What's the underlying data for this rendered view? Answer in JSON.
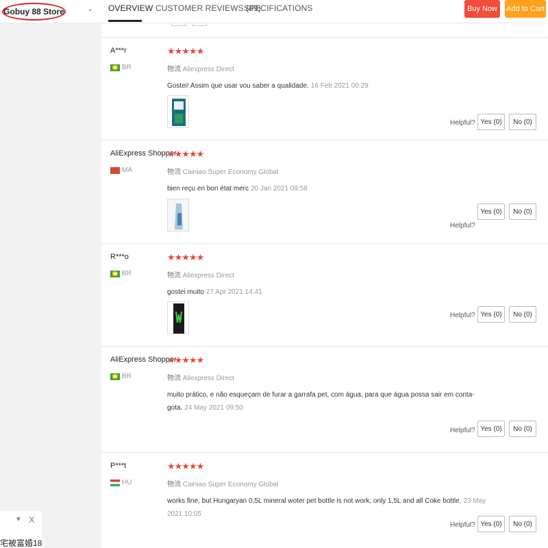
{
  "store": {
    "name": "Gobuy 88 Store",
    "chevron_icon": "chevron-down-icon"
  },
  "nav": {
    "tabs": [
      {
        "label": "OVERVIEW",
        "active": true
      },
      {
        "label": "CUSTOMER REVIEWS (89)",
        "active": false
      },
      {
        "label": "SPECIFICATIONS",
        "active": false
      }
    ],
    "buy_now": "Buy Now",
    "add_to_cart": "Add to Cart"
  },
  "colors": {
    "buy_now": "#f04d3b",
    "add_to_cart": "#ffa11d",
    "stars": "#e64a3b"
  },
  "helpful_label": "Helpful?",
  "reviews": [
    {
      "name": "A***r",
      "country": "BR",
      "stars": "★★★★★",
      "rating": 5,
      "shipping_prefix": "物流",
      "shipping": "Aliexpress Direct",
      "text": "Gostei! Assim que usar vou saber a qualidade.",
      "date": "16 Feb 2021 00:29",
      "yes": "Yes (0)",
      "no": "No (0)"
    },
    {
      "name": "AliExpress Shopper",
      "country": "MA",
      "stars": "★★★★★",
      "rating": 5,
      "shipping_prefix": "物流",
      "shipping": "Cainiao Super Economy Global",
      "text": "bien reçu en bon état merc",
      "date": "20 Jan 2021 09:58",
      "yes": "Yes (0)",
      "no": "No (0)"
    },
    {
      "name": "R***o",
      "country": "BR",
      "stars": "★★★★★",
      "rating": 5,
      "shipping_prefix": "物流",
      "shipping": "Aliexpress Direct",
      "text": "gostei muito",
      "date": "27 Apr 2021 14:41",
      "yes": "Yes (0)",
      "no": "No (0)"
    },
    {
      "name": "AliExpress Shopper",
      "country": "BR",
      "stars": "★★★★★",
      "rating": 5,
      "shipping_prefix": "物流",
      "shipping": "Aliexpress Direct",
      "text": "muito prático, e não esqueçam de furar a garrafa pet, com água, para que água possa sair em conta-gota.",
      "date": "24 May 2021 09:50",
      "yes": "Yes (0)",
      "no": "No (0)"
    },
    {
      "name": "P***t",
      "country": "HU",
      "stars": "★★★★★",
      "rating": 5,
      "shipping_prefix": "物流",
      "shipping": "Cainiao Super Economy Global",
      "text": "works fine, but Hungaryan 0,5L mineral woter pet bottle is not work, only 1,5L and all Coke bottle.",
      "date": "23 May 2021 10:05",
      "yes": "Yes (0)",
      "no": "No (0)"
    }
  ],
  "ad": {
    "down_icon": "▼",
    "close_icon": "X",
    "text": "宅被富婚18"
  }
}
